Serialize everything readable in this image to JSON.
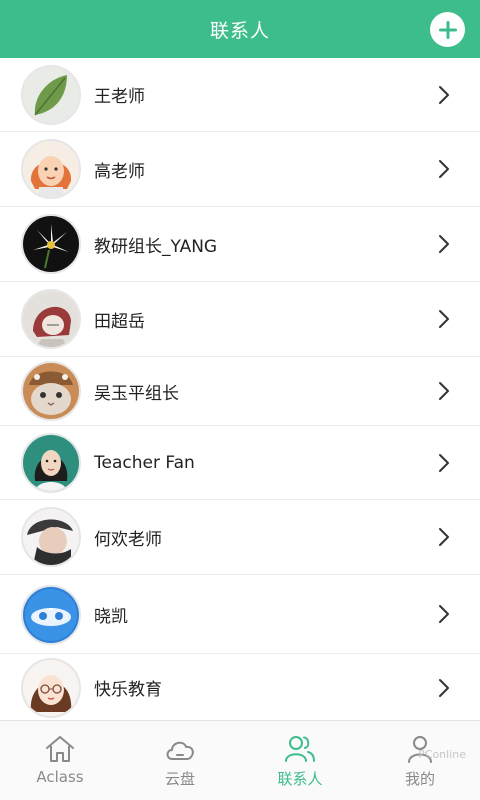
{
  "header": {
    "title": "联系人"
  },
  "contacts": [
    {
      "name": "王老师",
      "avatar": "leaf-avatar"
    },
    {
      "name": "高老师",
      "avatar": "cartoon-girl-avatar"
    },
    {
      "name": "教研组长_YANG",
      "avatar": "lily-flower-avatar"
    },
    {
      "name": "田超岳",
      "avatar": "hooded-figure-avatar"
    },
    {
      "name": "吴玉平组长",
      "avatar": "cat-avatar"
    },
    {
      "name": "Teacher Fan",
      "avatar": "woman-portrait-avatar"
    },
    {
      "name": "何欢老师",
      "avatar": "man-portrait-avatar"
    },
    {
      "name": "晓凯",
      "avatar": "blue-logo-avatar"
    },
    {
      "name": "快乐教育",
      "avatar": "cartoon-glasses-girl-avatar"
    }
  ],
  "tabs": [
    {
      "label": "Aclass",
      "icon": "home-icon",
      "active": false
    },
    {
      "label": "云盘",
      "icon": "cloud-icon",
      "active": false
    },
    {
      "label": "联系人",
      "icon": "contacts-icon",
      "active": true
    },
    {
      "label": "我的",
      "icon": "profile-icon",
      "active": false
    }
  ],
  "colors": {
    "accent": "#3ebd8c",
    "inactive": "#8a8a8a"
  },
  "watermark": "PConline"
}
